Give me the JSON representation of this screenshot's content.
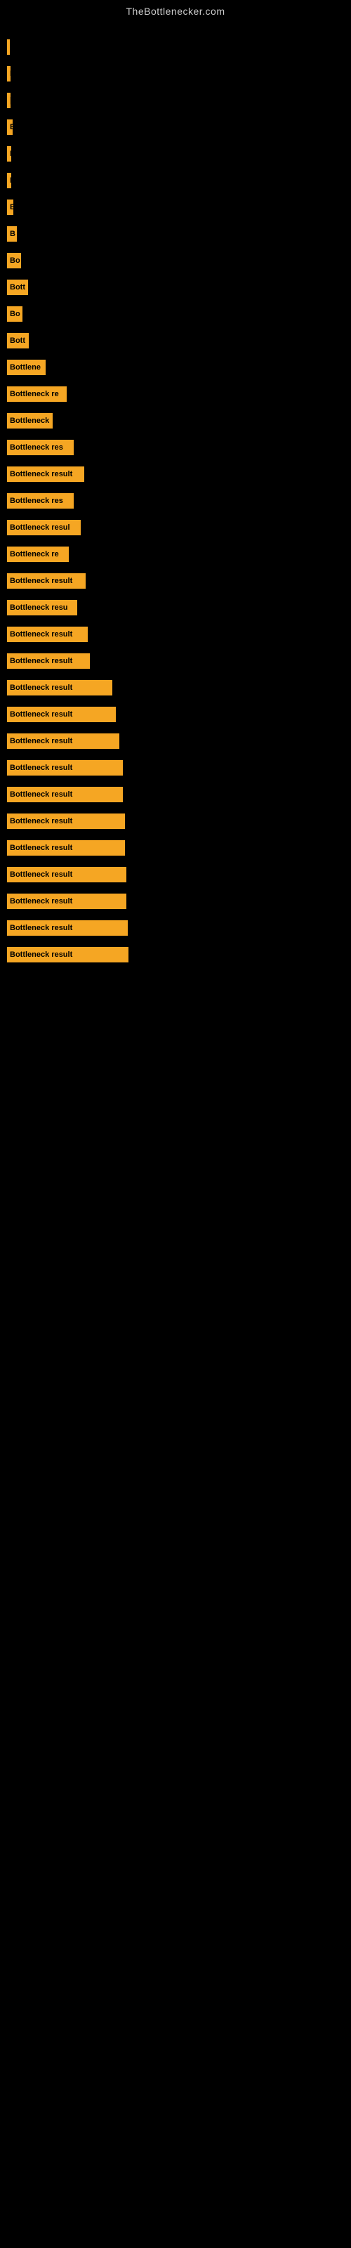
{
  "site": {
    "title": "TheBottlenecker.com"
  },
  "bars": [
    {
      "label": "|",
      "width": 4
    },
    {
      "label": "I",
      "width": 5
    },
    {
      "label": "|",
      "width": 5
    },
    {
      "label": "E",
      "width": 8
    },
    {
      "label": "I",
      "width": 6
    },
    {
      "label": "I",
      "width": 6
    },
    {
      "label": "E",
      "width": 9
    },
    {
      "label": "B",
      "width": 14
    },
    {
      "label": "Bo",
      "width": 20
    },
    {
      "label": "Bott",
      "width": 30
    },
    {
      "label": "Bo",
      "width": 22
    },
    {
      "label": "Bott",
      "width": 31
    },
    {
      "label": "Bottlene",
      "width": 55
    },
    {
      "label": "Bottleneck re",
      "width": 85
    },
    {
      "label": "Bottleneck",
      "width": 65
    },
    {
      "label": "Bottleneck res",
      "width": 95
    },
    {
      "label": "Bottleneck result",
      "width": 110
    },
    {
      "label": "Bottleneck res",
      "width": 95
    },
    {
      "label": "Bottleneck resul",
      "width": 105
    },
    {
      "label": "Bottleneck re",
      "width": 88
    },
    {
      "label": "Bottleneck result",
      "width": 112
    },
    {
      "label": "Bottleneck resu",
      "width": 100
    },
    {
      "label": "Bottleneck result",
      "width": 115
    },
    {
      "label": "Bottleneck result",
      "width": 118
    },
    {
      "label": "Bottleneck result",
      "width": 150
    },
    {
      "label": "Bottleneck result",
      "width": 155
    },
    {
      "label": "Bottleneck result",
      "width": 160
    },
    {
      "label": "Bottleneck result",
      "width": 165
    },
    {
      "label": "Bottleneck result",
      "width": 165
    },
    {
      "label": "Bottleneck result",
      "width": 168
    },
    {
      "label": "Bottleneck result",
      "width": 168
    },
    {
      "label": "Bottleneck result",
      "width": 170
    },
    {
      "label": "Bottleneck result",
      "width": 170
    },
    {
      "label": "Bottleneck result",
      "width": 172
    },
    {
      "label": "Bottleneck result",
      "width": 173
    }
  ]
}
